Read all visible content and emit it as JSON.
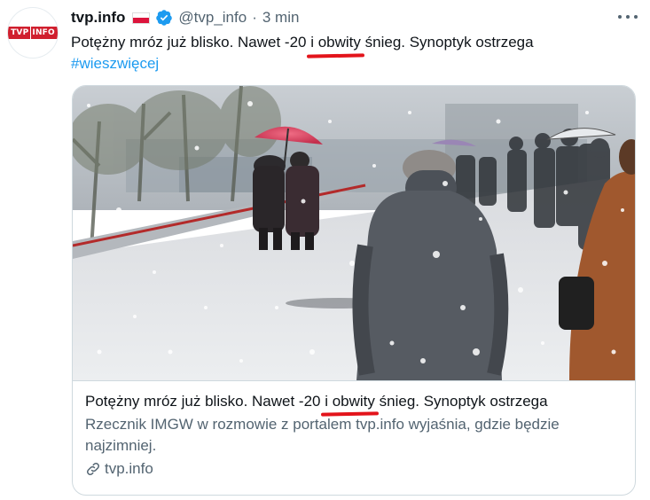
{
  "tweet": {
    "author": {
      "logo_left": "TVP",
      "logo_right": "INFO",
      "name": "tvp.info",
      "handle": "@tvp_info",
      "separator": "·",
      "time": "3 min",
      "flag_icon": "poland-flag-icon",
      "verified_icon": "verified-badge-icon"
    },
    "text": {
      "part1": "Potężny mróz już blisko. Nawet -20 ",
      "marked": "i obwity",
      "part2": " śnieg. Synoptyk ostrzega",
      "hashtag": "#wieszwięcej"
    },
    "card": {
      "title_part1": "Potężny mróz już blisko. Nawet -20 ",
      "title_marked": "i obwity",
      "title_part2": " śnieg. Synoptyk ostrzega",
      "description": "Rzecznik IMGW w rozmowie z portalem tvp.info wyjaśnia, gdzie będzie najzimniej.",
      "domain": "tvp.info",
      "domain_icon": "link-icon",
      "image_icon": "snowy-street-photo"
    },
    "menu_icon": "more-dots-icon"
  },
  "colors": {
    "link": "#1d9bf0",
    "secondary_text": "#536471",
    "underline_mark": "#e3141b",
    "brand_red": "#d01f2e"
  }
}
